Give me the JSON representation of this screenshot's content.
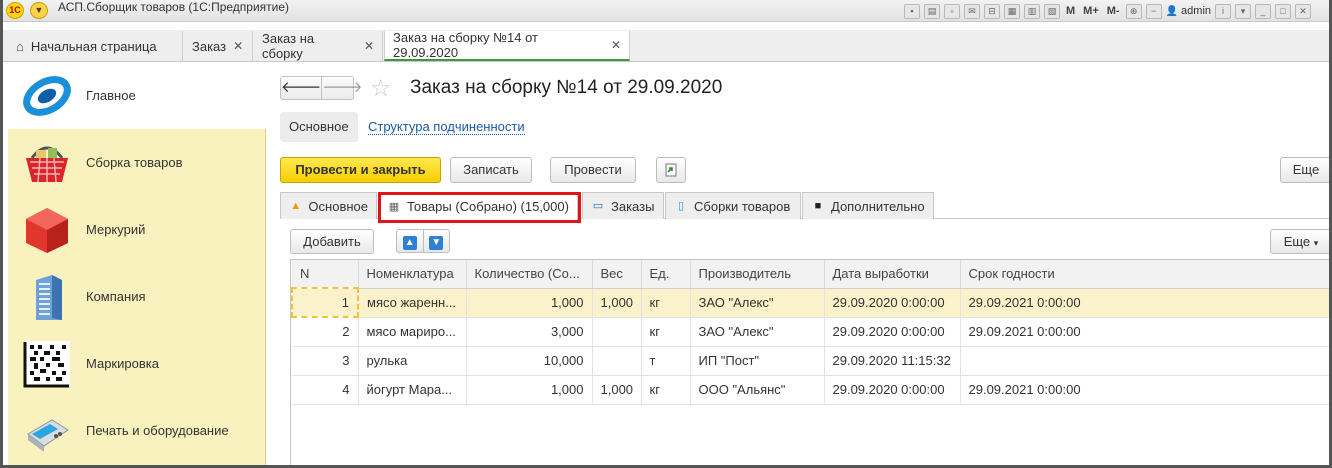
{
  "app_title": "АСП.Сборщик товаров  (1С:Предприятие)",
  "titlebar": {
    "mem_labels": [
      "M",
      "M+",
      "M-"
    ],
    "user": "admin"
  },
  "tabs": [
    {
      "label": "Начальная страница"
    },
    {
      "label": "Заказ"
    },
    {
      "label": "Заказ на сборку"
    },
    {
      "label": "Заказ на сборку №14 от 29.09.2020"
    }
  ],
  "sidebar": {
    "items": [
      {
        "label": "Главное",
        "icon": "main-section-icon"
      },
      {
        "label": "Сборка товаров",
        "icon": "basket-icon"
      },
      {
        "label": "Меркурий",
        "icon": "cube-icon"
      },
      {
        "label": "Компания",
        "icon": "building-icon"
      },
      {
        "label": "Маркировка",
        "icon": "datamatrix-icon"
      },
      {
        "label": "Печать и оборудование",
        "icon": "payment-terminal-icon"
      }
    ]
  },
  "document": {
    "title": "Заказ на сборку №14 от 29.09.2020",
    "subnav_main": "Основное",
    "subnav_link": "Структура подчиненности"
  },
  "toolbar": {
    "post_close": "Провести и закрыть",
    "save": "Записать",
    "post": "Провести",
    "more": "Еще"
  },
  "inner_tabs": [
    {
      "label": "Основное",
      "icon": "warning-icon"
    },
    {
      "label": "Товары (Собрано) (15,000)",
      "icon": "building-list-icon"
    },
    {
      "label": "Заказы",
      "icon": "card-icon"
    },
    {
      "label": "Сборки товаров",
      "icon": "phone-icon"
    },
    {
      "label": "Дополнительно",
      "icon": "chat-icon"
    }
  ],
  "table_toolbar": {
    "add": "Добавить",
    "more": "Еще"
  },
  "table": {
    "columns": [
      "N",
      "Номенклатура",
      "Количество (Со...",
      "Вес",
      "Ед.",
      "Производитель",
      "Дата выработки",
      "Срок годности"
    ],
    "rows": [
      [
        "1",
        "мясо жаренн...",
        "1,000",
        "1,000",
        "кг",
        "ЗАО \"Алекс\"",
        "29.09.2020 0:00:00",
        "29.09.2021 0:00:00"
      ],
      [
        "2",
        "мясо мариро...",
        "3,000",
        "",
        "кг",
        "ЗАО \"Алекс\"",
        "29.09.2020 0:00:00",
        "29.09.2021 0:00:00"
      ],
      [
        "3",
        "рулька",
        "10,000",
        "",
        "т",
        "ИП \"Пост\"",
        "29.09.2020 11:15:32",
        ""
      ],
      [
        "4",
        "йогурт Мара...",
        "1,000",
        "1,000",
        "кг",
        "ООО \"Альянс\"",
        "29.09.2020 0:00:00",
        "29.09.2021 0:00:00"
      ]
    ]
  },
  "colors": {
    "sidebar_bg": "#faf2be",
    "primary_button": "#f6cf00",
    "active_tab_underline": "#3c9a3c",
    "highlight_box": "#e1141c",
    "selected_row": "#fbf1cb"
  }
}
